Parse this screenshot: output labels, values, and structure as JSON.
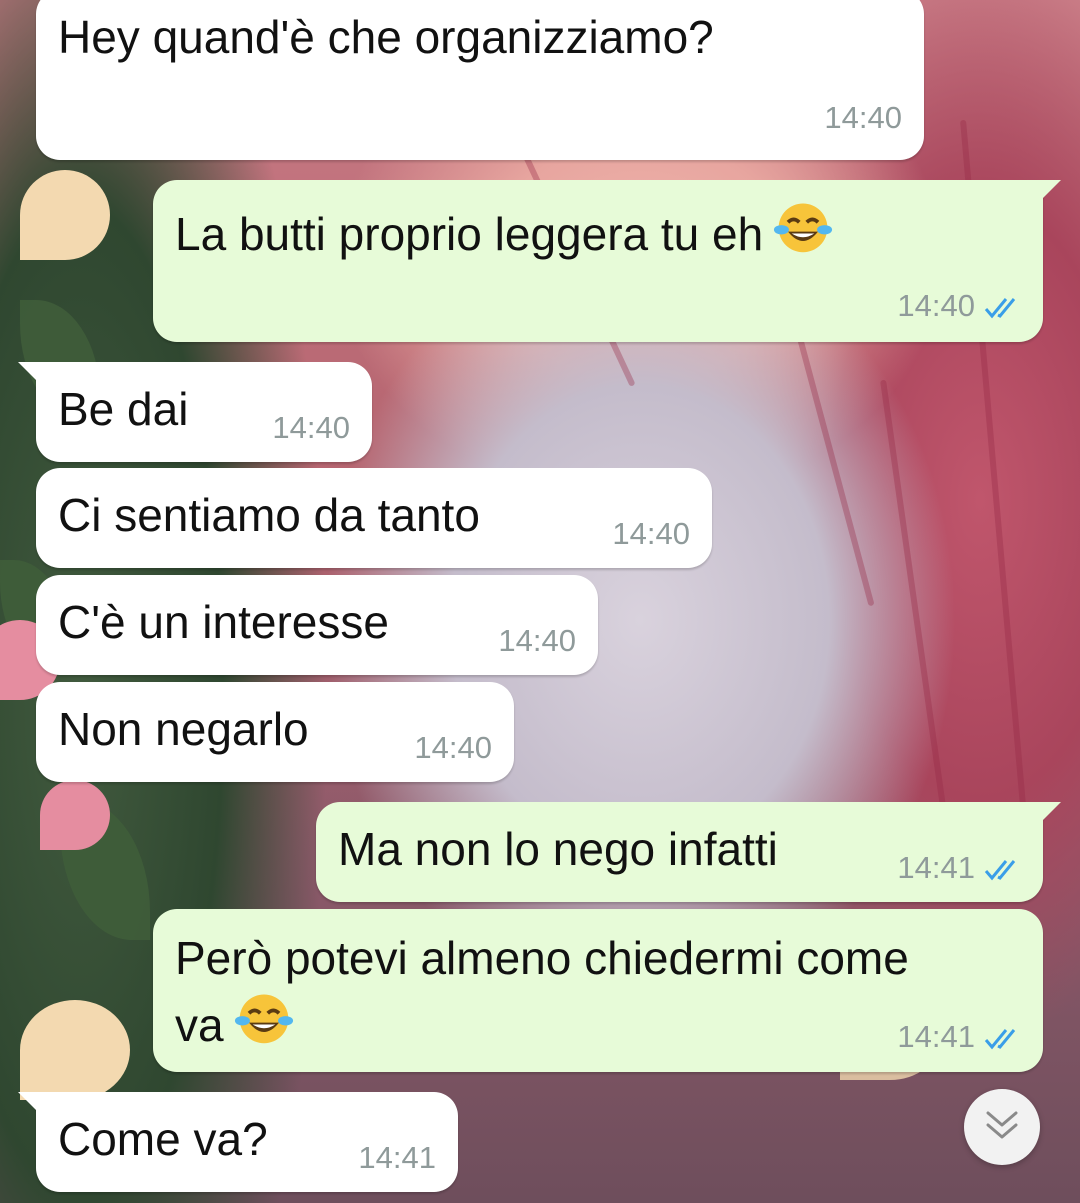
{
  "messages": [
    {
      "text": "Hey quand'è che organizziamo?",
      "time": "14:40",
      "direction": "incoming"
    },
    {
      "text": "La butti proprio leggera tu eh",
      "emoji": "face-with-tears-of-joy",
      "time": "14:40",
      "direction": "outgoing",
      "status": "read"
    },
    {
      "text": "Be dai",
      "time": "14:40",
      "direction": "incoming"
    },
    {
      "text": "Ci sentiamo da tanto",
      "time": "14:40",
      "direction": "incoming"
    },
    {
      "text": "C'è un interesse",
      "time": "14:40",
      "direction": "incoming"
    },
    {
      "text": "Non negarlo",
      "time": "14:40",
      "direction": "incoming"
    },
    {
      "text": "Ma non lo nego infatti",
      "time": "14:41",
      "direction": "outgoing",
      "status": "read"
    },
    {
      "text_line1": "Però potevi almeno chiedermi come",
      "text_line2": "va",
      "emoji": "face-with-tears-of-joy",
      "time": "14:41",
      "direction": "outgoing",
      "status": "read"
    },
    {
      "text": "Come va?",
      "time": "14:41",
      "direction": "incoming"
    }
  ],
  "colors": {
    "incoming_bubble": "#ffffff",
    "outgoing_bubble": "#e7fbd8",
    "timestamp": "#8f9a9a",
    "read_ticks": "#3a9ee8"
  },
  "scroll_button": {
    "icon": "double-chevron-down-icon"
  }
}
